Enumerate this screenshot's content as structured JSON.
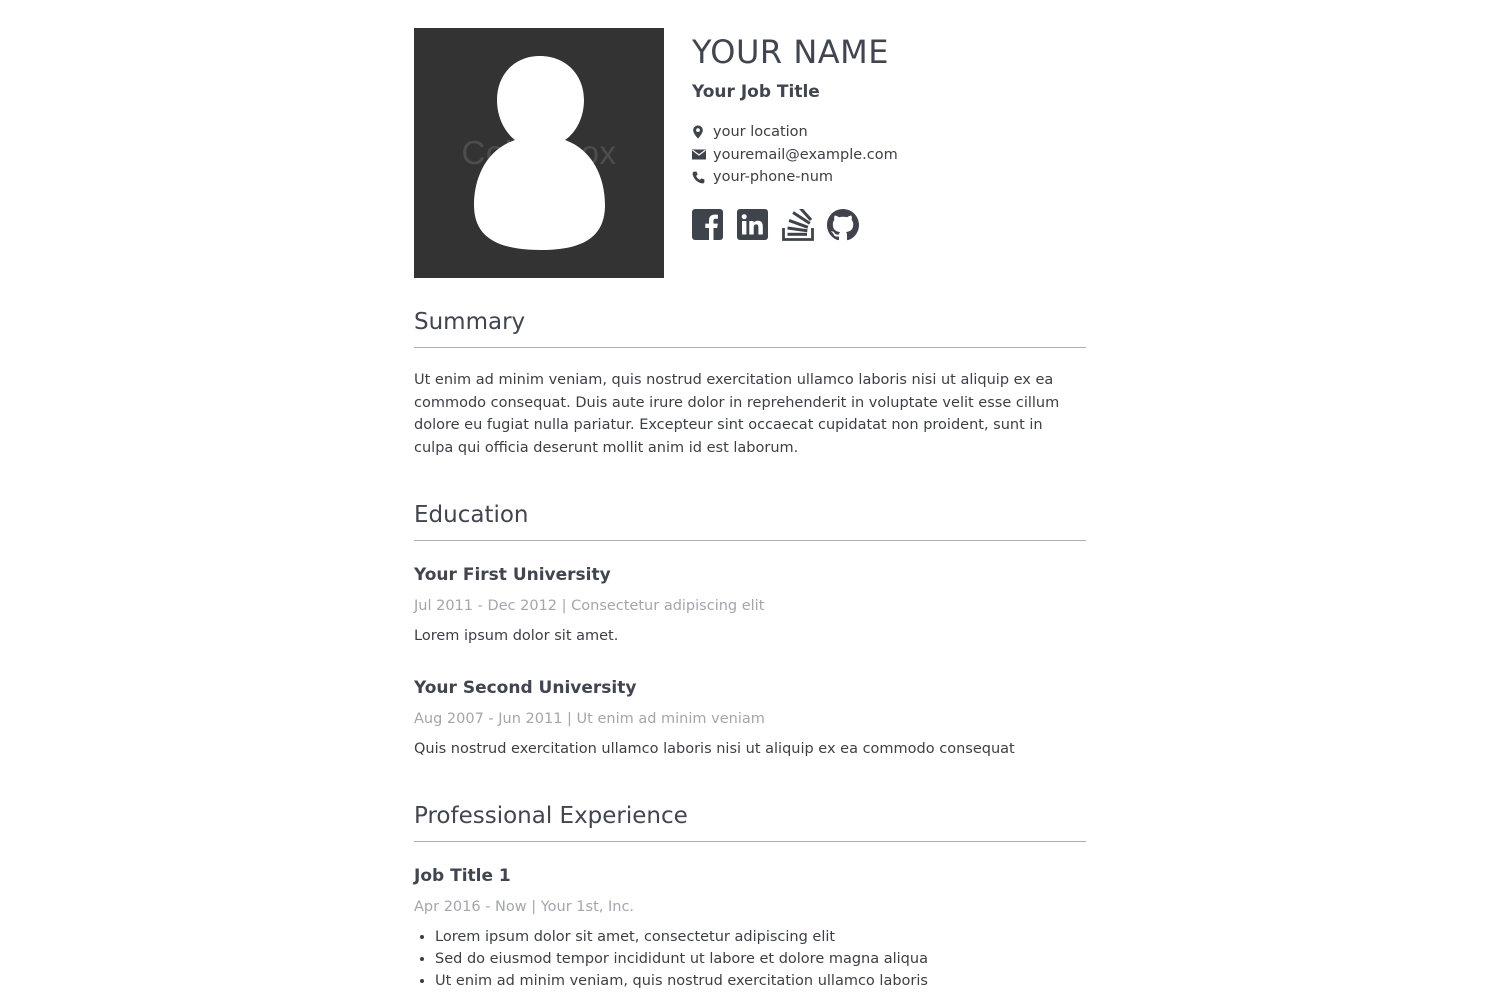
{
  "header": {
    "name": "YOUR NAME",
    "job_title": "Your Job Title",
    "photo_watermark": "Colourbox",
    "contacts": [
      {
        "icon": "map-pin-icon",
        "text": "your location"
      },
      {
        "icon": "envelope-icon",
        "text": "youremail@example.com"
      },
      {
        "icon": "phone-icon",
        "text": "your-phone-num"
      }
    ],
    "social": [
      "facebook-icon",
      "linkedin-icon",
      "stackoverflow-icon",
      "github-icon"
    ]
  },
  "summary": {
    "heading": "Summary",
    "text": "Ut enim ad minim veniam, quis nostrud exercitation ullamco laboris nisi ut aliquip ex ea commodo consequat. Duis aute irure dolor in reprehenderit in voluptate velit esse cillum dolore eu fugiat nulla pariatur. Excepteur sint occaecat cupidatat non proident, sunt in culpa qui officia deserunt mollit anim id est laborum."
  },
  "education": {
    "heading": "Education",
    "items": [
      {
        "school": "Your First University",
        "meta": "Jul 2011 - Dec 2012 | Consectetur adipiscing elit",
        "desc": "Lorem ipsum dolor sit amet."
      },
      {
        "school": "Your Second University",
        "meta": "Aug 2007 - Jun 2011 | Ut enim ad minim veniam",
        "desc": "Quis nostrud exercitation ullamco laboris nisi ut aliquip ex ea commodo consequat"
      }
    ]
  },
  "experience": {
    "heading": "Professional Experience",
    "items": [
      {
        "title": "Job Title 1",
        "meta": "Apr 2016 - Now | Your 1st, Inc.",
        "bullets": [
          "Lorem ipsum dolor sit amet, consectetur adipiscing elit",
          "Sed do eiusmod tempor incididunt ut labore et dolore magna aliqua",
          "Ut enim ad minim veniam, quis nostrud exercitation ullamco laboris"
        ]
      }
    ]
  },
  "colors": {
    "text": "#3b3f46",
    "heading": "#414550",
    "muted": "#a3a6ad",
    "rule": "#a9acb2",
    "photo_bg": "#333333",
    "icon": "#3f434b"
  }
}
